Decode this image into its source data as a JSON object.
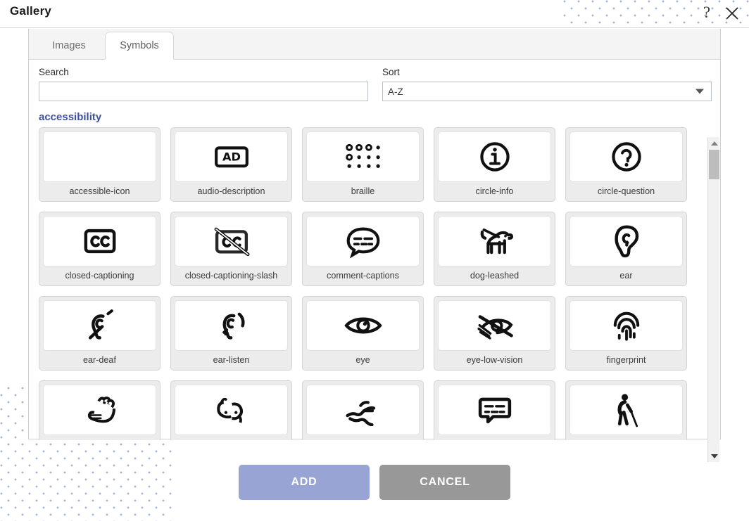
{
  "window": {
    "title": "Gallery",
    "help_icon": "question-mark-icon",
    "close_icon": "close-x-icon"
  },
  "tabs": [
    {
      "label": "Images",
      "active": false
    },
    {
      "label": "Symbols",
      "active": true
    }
  ],
  "search": {
    "label": "Search",
    "value": "",
    "placeholder": ""
  },
  "sort": {
    "label": "Sort",
    "value": "A-Z",
    "options": [
      "A-Z"
    ],
    "caret_icon": "chevron-down-icon"
  },
  "category": {
    "name": "accessibility",
    "color": "#3d4fa0"
  },
  "symbols": [
    {
      "name": "accessible-icon",
      "glyph": "blank"
    },
    {
      "name": "audio-description",
      "glyph": "ad-box"
    },
    {
      "name": "braille",
      "glyph": "braille-dots"
    },
    {
      "name": "circle-info",
      "glyph": "circle-info"
    },
    {
      "name": "circle-question",
      "glyph": "circle-question"
    },
    {
      "name": "closed-captioning",
      "glyph": "cc-box"
    },
    {
      "name": "closed-captioning-slash",
      "glyph": "cc-box-slash"
    },
    {
      "name": "comment-captions",
      "glyph": "comment-captions"
    },
    {
      "name": "dog-leashed",
      "glyph": "dog-leashed"
    },
    {
      "name": "ear",
      "glyph": "ear"
    },
    {
      "name": "ear-deaf",
      "glyph": "ear-deaf"
    },
    {
      "name": "ear-listen",
      "glyph": "ear-listen"
    },
    {
      "name": "eye",
      "glyph": "eye"
    },
    {
      "name": "eye-low-vision",
      "glyph": "eye-slash"
    },
    {
      "name": "fingerprint",
      "glyph": "fingerprint"
    },
    {
      "name": "",
      "glyph": "hand-open"
    },
    {
      "name": "",
      "glyph": "hands-asl"
    },
    {
      "name": "",
      "glyph": "hands-holding"
    },
    {
      "name": "",
      "glyph": "message-captions"
    },
    {
      "name": "",
      "glyph": "person-cane"
    }
  ],
  "scrollbar": {
    "up_icon": "scroll-up-arrow",
    "down_icon": "scroll-down-arrow"
  },
  "actions": {
    "add_label": "ADD",
    "add_color": "#97a4d4",
    "cancel_label": "CANCEL",
    "cancel_color": "#989898"
  }
}
